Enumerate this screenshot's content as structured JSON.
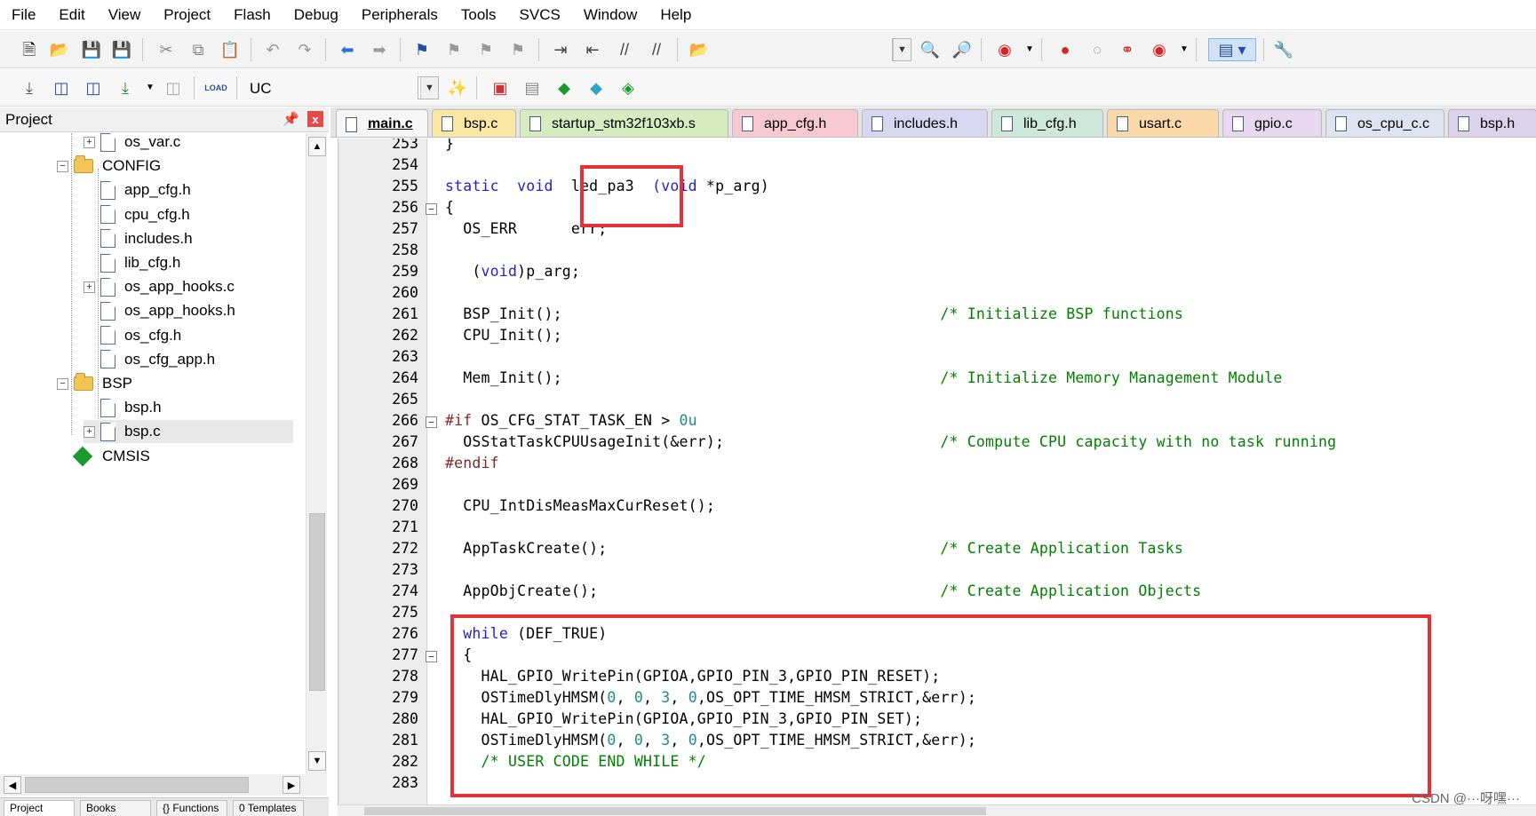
{
  "menu": [
    "File",
    "Edit",
    "View",
    "Project",
    "Flash",
    "Debug",
    "Peripherals",
    "Tools",
    "SVCS",
    "Window",
    "Help"
  ],
  "toolbar2": {
    "target_name": "UC"
  },
  "project_panel": {
    "title": "Project",
    "pin_icon": "pin-icon",
    "close_label": "x",
    "tree": [
      {
        "label": "os_var.c",
        "kind": "file",
        "level": 2,
        "expander": "+"
      },
      {
        "label": "CONFIG",
        "kind": "folder",
        "level": 1,
        "expander": "-"
      },
      {
        "label": "app_cfg.h",
        "kind": "file",
        "level": 2
      },
      {
        "label": "cpu_cfg.h",
        "kind": "file",
        "level": 2
      },
      {
        "label": "includes.h",
        "kind": "file",
        "level": 2
      },
      {
        "label": "lib_cfg.h",
        "kind": "file",
        "level": 2
      },
      {
        "label": "os_app_hooks.c",
        "kind": "file",
        "level": 2,
        "expander": "+"
      },
      {
        "label": "os_app_hooks.h",
        "kind": "file",
        "level": 2
      },
      {
        "label": "os_cfg.h",
        "kind": "file",
        "level": 2
      },
      {
        "label": "os_cfg_app.h",
        "kind": "file",
        "level": 2
      },
      {
        "label": "BSP",
        "kind": "folder",
        "level": 1,
        "expander": "-"
      },
      {
        "label": "bsp.h",
        "kind": "file",
        "level": 2
      },
      {
        "label": "bsp.c",
        "kind": "file",
        "level": 2,
        "expander": "+",
        "selected": true
      },
      {
        "label": "CMSIS",
        "kind": "cmsis",
        "level": 1
      }
    ],
    "bottom_tabs": [
      "Project",
      "Books",
      "{} Functions",
      "0 Templates"
    ]
  },
  "editor_tabs": [
    {
      "label": "main.c",
      "active": true,
      "color": "#f6f6f6"
    },
    {
      "label": "bsp.c",
      "color": "#fbe7a4"
    },
    {
      "label": "startup_stm32f103xb.s",
      "color": "#d4ecc0"
    },
    {
      "label": "app_cfg.h",
      "color": "#f7c8cf"
    },
    {
      "label": "includes.h",
      "color": "#d8d6f0"
    },
    {
      "label": "lib_cfg.h",
      "color": "#cde7da"
    },
    {
      "label": "usart.c",
      "color": "#fbd8a9"
    },
    {
      "label": "gpio.c",
      "color": "#e8d8ef"
    },
    {
      "label": "os_cpu_c.c",
      "color": "#dde3f0"
    },
    {
      "label": "bsp.h",
      "color": "#dcd2ec"
    }
  ],
  "code_lines": [
    {
      "n": "253",
      "fold": "",
      "html": "}"
    },
    {
      "n": "254",
      "fold": "",
      "html": ""
    },
    {
      "n": "255",
      "fold": "",
      "html": "<span class=\"kw\">static</span>  <span class=\"kw\">void</span>  led_pa3  <span class=\"kw\">(void</span> *p_arg)"
    },
    {
      "n": "256",
      "fold": "-",
      "html": "{"
    },
    {
      "n": "257",
      "fold": "",
      "html": "  OS_ERR      err;"
    },
    {
      "n": "258",
      "fold": "",
      "html": ""
    },
    {
      "n": "259",
      "fold": "",
      "html": "   (<span class=\"kw\">void</span>)p_arg;"
    },
    {
      "n": "260",
      "fold": "",
      "html": ""
    },
    {
      "n": "261",
      "fold": "",
      "html": "  BSP_Init();                                          <span class=\"cm\">/* Initialize BSP functions</span>"
    },
    {
      "n": "262",
      "fold": "",
      "html": "  CPU_Init();"
    },
    {
      "n": "263",
      "fold": "",
      "html": ""
    },
    {
      "n": "264",
      "fold": "",
      "html": "  Mem_Init();                                          <span class=\"cm\">/* Initialize Memory Management Module</span>"
    },
    {
      "n": "265",
      "fold": "",
      "html": ""
    },
    {
      "n": "266",
      "fold": "-",
      "html": "<span class=\"pp\">#if</span> OS_CFG_STAT_TASK_EN &gt; <span class=\"num\">0u</span>"
    },
    {
      "n": "267",
      "fold": "",
      "html": "  OSStatTaskCPUUsageInit(&amp;err);                        <span class=\"cm\">/* Compute CPU capacity with no task running</span>"
    },
    {
      "n": "268",
      "fold": "",
      "html": "<span class=\"pp\">#endif</span>"
    },
    {
      "n": "269",
      "fold": "",
      "html": ""
    },
    {
      "n": "270",
      "fold": "",
      "html": "  CPU_IntDisMeasMaxCurReset();"
    },
    {
      "n": "271",
      "fold": "",
      "html": ""
    },
    {
      "n": "272",
      "fold": "",
      "html": "  AppTaskCreate();                                     <span class=\"cm\">/* Create Application Tasks</span>"
    },
    {
      "n": "273",
      "fold": "",
      "html": ""
    },
    {
      "n": "274",
      "fold": "",
      "html": "  AppObjCreate();                                      <span class=\"cm\">/* Create Application Objects</span>"
    },
    {
      "n": "275",
      "fold": "",
      "html": ""
    },
    {
      "n": "276",
      "fold": "",
      "html": "  <span class=\"kw\">while</span> (DEF_TRUE)"
    },
    {
      "n": "277",
      "fold": "-",
      "html": "  {"
    },
    {
      "n": "278",
      "fold": "",
      "html": "    HAL_GPIO_WritePin(GPIOA,GPIO_PIN_3,GPIO_PIN_RESET);"
    },
    {
      "n": "279",
      "fold": "",
      "html": "    OSTimeDlyHMSM(<span class=\"num\">0</span>, <span class=\"num\">0</span>, <span class=\"num\">3</span>, <span class=\"num\">0</span>,OS_OPT_TIME_HMSM_STRICT,&amp;err);"
    },
    {
      "n": "280",
      "fold": "",
      "html": "    HAL_GPIO_WritePin(GPIOA,GPIO_PIN_3,GPIO_PIN_SET);"
    },
    {
      "n": "281",
      "fold": "",
      "html": "    OSTimeDlyHMSM(<span class=\"num\">0</span>, <span class=\"num\">0</span>, <span class=\"num\">3</span>, <span class=\"num\">0</span>,OS_OPT_TIME_HMSM_STRICT,&amp;err);"
    },
    {
      "n": "282",
      "fold": "",
      "html": "    <span class=\"cm\">/* USER CODE END WHILE */</span>"
    },
    {
      "n": "283",
      "fold": "",
      "html": ""
    }
  ],
  "colors": {
    "highlight_box": "#e53238",
    "keyword": "#1f1fd2",
    "comment": "#008000",
    "number": "#1f8a8a"
  },
  "watermark": "CSDN @···呀嘿···"
}
